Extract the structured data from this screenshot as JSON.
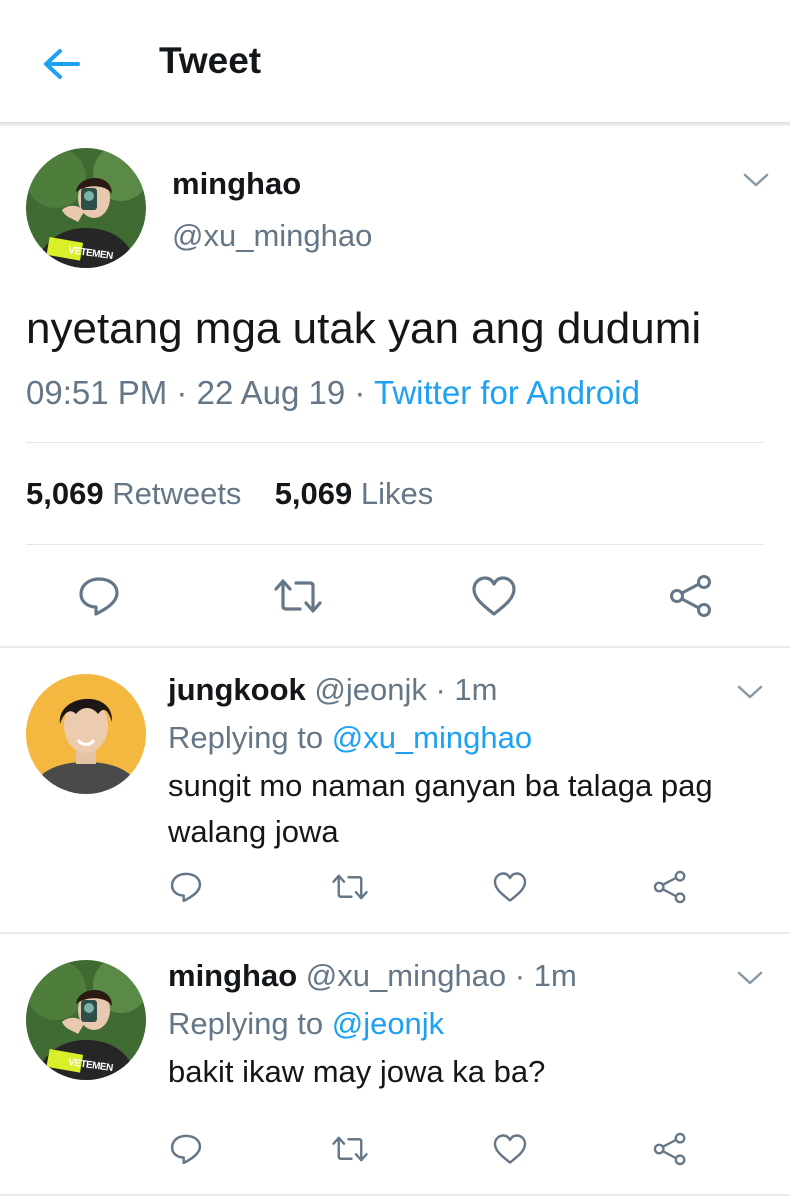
{
  "header": {
    "title": "Tweet"
  },
  "main_tweet": {
    "display_name": "minghao",
    "handle": "@xu_minghao",
    "text": "nyetang mga utak yan ang dudumi",
    "time": "09:51 PM",
    "date": "22 Aug 19",
    "sep": "·",
    "source": "Twitter for Android",
    "retweets_count": "5,069",
    "retweets_label": "Retweets",
    "likes_count": "5,069",
    "likes_label": "Likes",
    "avatar_text": "VETEMEN"
  },
  "replies": [
    {
      "display_name": "jungkook",
      "handle": "@jeonjk",
      "meta": "· 1m",
      "replying_label": "Replying to",
      "replying_to": "@xu_minghao",
      "text_line1": "sungit mo naman ganyan ba talaga pag",
      "text_line2": "walang jowa"
    },
    {
      "display_name": "minghao",
      "handle": "@xu_minghao",
      "meta": "· 1m",
      "replying_label": "Replying to",
      "replying_to": "@jeonjk",
      "text_line1": "bakit ikaw may jowa ka ba?",
      "avatar_text": "VETEMEN"
    }
  ],
  "colors": {
    "accent": "#1da1f2",
    "muted": "#657786",
    "text": "#14171a",
    "divider": "#e1e8ed"
  },
  "icons": [
    "back-arrow-icon",
    "chevron-down-icon",
    "reply-icon",
    "retweet-icon",
    "like-icon",
    "share-icon"
  ]
}
